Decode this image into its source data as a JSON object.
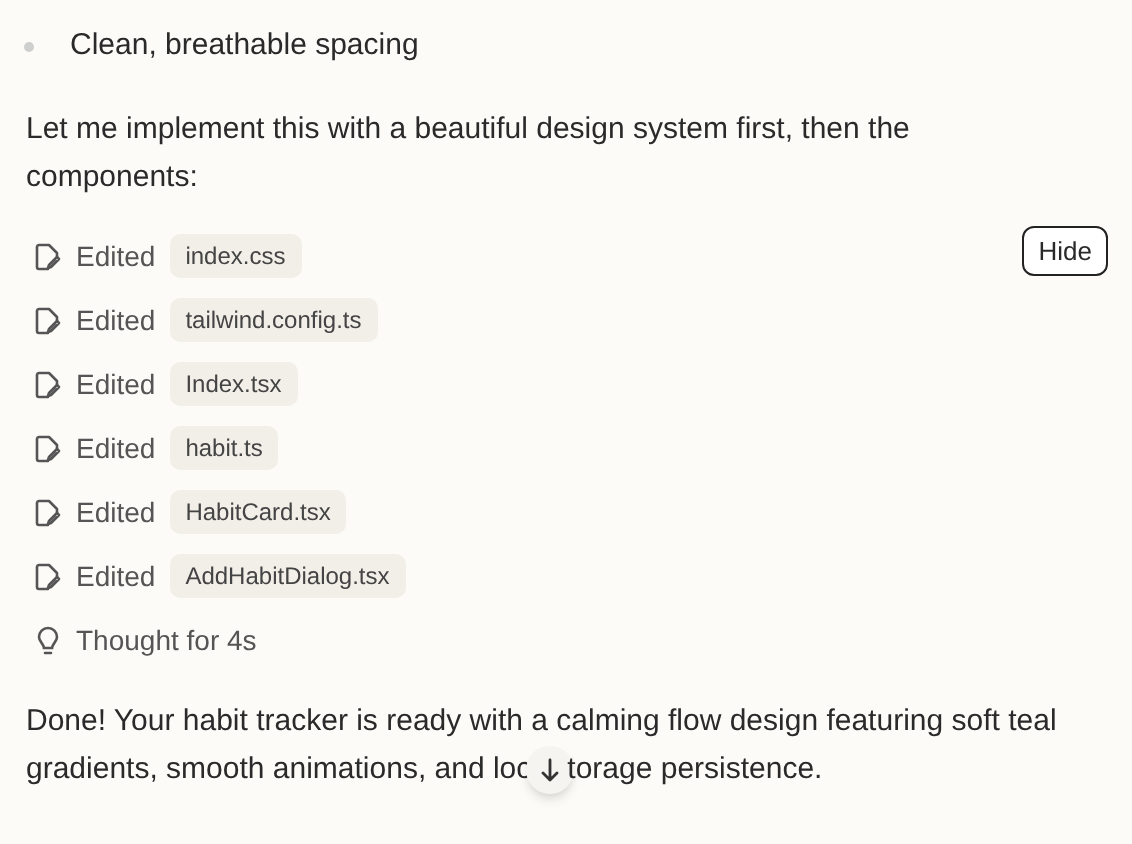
{
  "bullets": [
    "Clean, breathable spacing"
  ],
  "intro": "Let me implement this with a beautiful design system first, then the components:",
  "hide_button": "Hide",
  "edits": [
    {
      "action": "Edited",
      "file": "index.css"
    },
    {
      "action": "Edited",
      "file": "tailwind.config.ts"
    },
    {
      "action": "Edited",
      "file": "Index.tsx"
    },
    {
      "action": "Edited",
      "file": "habit.ts"
    },
    {
      "action": "Edited",
      "file": "HabitCard.tsx"
    },
    {
      "action": "Edited",
      "file": "AddHabitDialog.tsx"
    }
  ],
  "thought": "Thought for 4s",
  "summary": {
    "line_1": "Done! Your habit tracker is ready with a calming flow design featuring soft teal",
    "line_2_start": "gradients, smooth animations, and loc",
    "line_2_end": "torage persistence."
  }
}
